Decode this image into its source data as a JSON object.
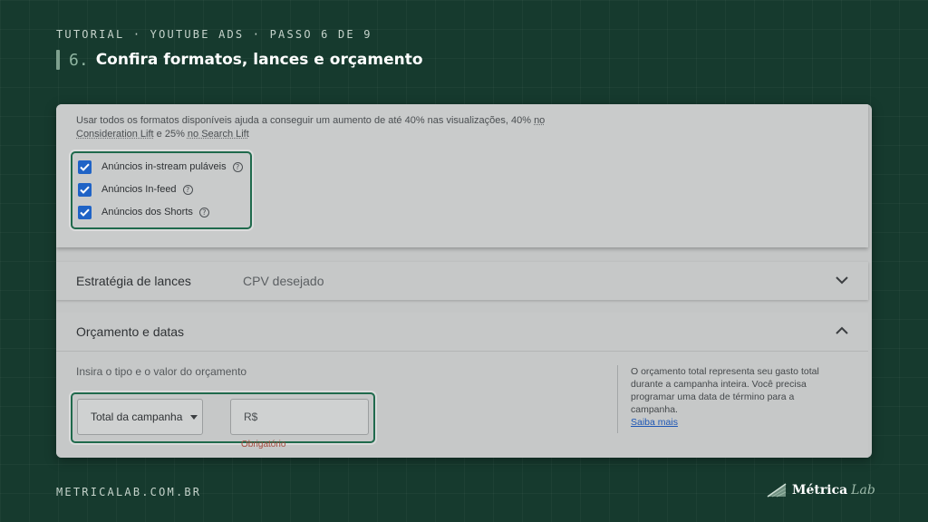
{
  "header": {
    "eyebrow": "TUTORIAL · YOUTUBE ADS · PASSO 6 DE 9",
    "step_number": "6.",
    "title": "Confira formatos, lances e orçamento"
  },
  "formats": {
    "description_part1": "Usar todos os formatos disponíveis ajuda a conseguir um aumento de até 40% nas visualizações, 40% ",
    "description_link1": "no Consideration Lift",
    "description_part2": " e 25% ",
    "description_link2": "no Search Lift",
    "options": [
      {
        "label": "Anúncios in-stream puláveis",
        "checked": true,
        "icon": "help-icon"
      },
      {
        "label": "Anúncios In-feed",
        "checked": true,
        "icon": "help-icon"
      },
      {
        "label": "Anúncios dos Shorts",
        "checked": true,
        "icon": "help-icon"
      }
    ]
  },
  "bidding": {
    "label": "Estratégia de lances",
    "value": "CPV desejado",
    "icon": "chevron-down-icon"
  },
  "budget": {
    "label": "Orçamento e datas",
    "icon": "chevron-up-icon",
    "subtitle": "Insira o tipo e o valor do orçamento",
    "type_select": "Total da campanha",
    "amount_placeholder": "R$",
    "required_text": "Obrigatório",
    "info_text": "O orçamento total representa seu gasto total durante a campanha inteira. Você precisa programar uma data de término para a campanha.",
    "info_link": "Saiba mais"
  },
  "footer": {
    "url": "METRICALAB.COM.BR",
    "logo_text": "Métrica",
    "logo_suffix": "Lab"
  },
  "colors": {
    "background": "#163a2e",
    "checkbox_blue": "#1f63c6",
    "highlight_green": "#1f6a4c",
    "link_blue": "#1d56b5"
  }
}
